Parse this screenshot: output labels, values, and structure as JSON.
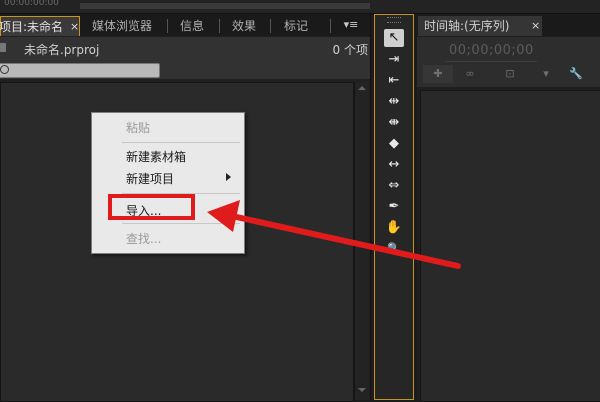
{
  "top": {
    "timecode": "00:00:00:00"
  },
  "project_panel": {
    "tabs": {
      "project": "项目:未命名",
      "project_close": "×",
      "media_browser": "媒体浏览器",
      "info": "信息",
      "effects": "效果",
      "markers": "标记",
      "menu": "▾≡"
    },
    "file_name": "未命名.prproj",
    "item_count": "0 个项"
  },
  "context_menu": {
    "items": [
      {
        "label": "粘贴",
        "enabled": false
      },
      {
        "label": "新建素材箱",
        "enabled": true
      },
      {
        "label": "新建项目",
        "enabled": true,
        "has_submenu": true
      },
      {
        "label": "导入...",
        "enabled": true,
        "highlighted": true
      },
      {
        "label": "查找...",
        "enabled": false
      }
    ]
  },
  "tools": [
    {
      "name": "selection-tool-icon",
      "glyph": "↖"
    },
    {
      "name": "track-select-tool-icon",
      "glyph": "⇥"
    },
    {
      "name": "ripple-edit-tool-icon",
      "glyph": "⇤"
    },
    {
      "name": "rolling-edit-tool-icon",
      "glyph": "⇹"
    },
    {
      "name": "rate-stretch-tool-icon",
      "glyph": "⇼"
    },
    {
      "name": "razor-tool-icon",
      "glyph": "◆"
    },
    {
      "name": "slip-tool-icon",
      "glyph": "↔"
    },
    {
      "name": "slide-tool-icon",
      "glyph": "⇔"
    },
    {
      "name": "pen-tool-icon",
      "glyph": "✒"
    },
    {
      "name": "hand-tool-icon",
      "glyph": "✋"
    },
    {
      "name": "zoom-tool-icon",
      "glyph": "🔍"
    }
  ],
  "timeline_panel": {
    "tab": "时间轴:(无序列)",
    "tab_close": "×",
    "timecode": "00;00;00;00",
    "buttons": [
      {
        "name": "snap-icon",
        "glyph": "✚"
      },
      {
        "name": "link-icon",
        "glyph": "∞"
      },
      {
        "name": "marker-icon",
        "glyph": "⊡"
      },
      {
        "name": "add-marker-icon",
        "glyph": "▾"
      },
      {
        "name": "wrench-icon",
        "glyph": "🔧"
      }
    ]
  },
  "colors": {
    "accent_border": "#c8961e",
    "annotation": "#e01b1b"
  }
}
